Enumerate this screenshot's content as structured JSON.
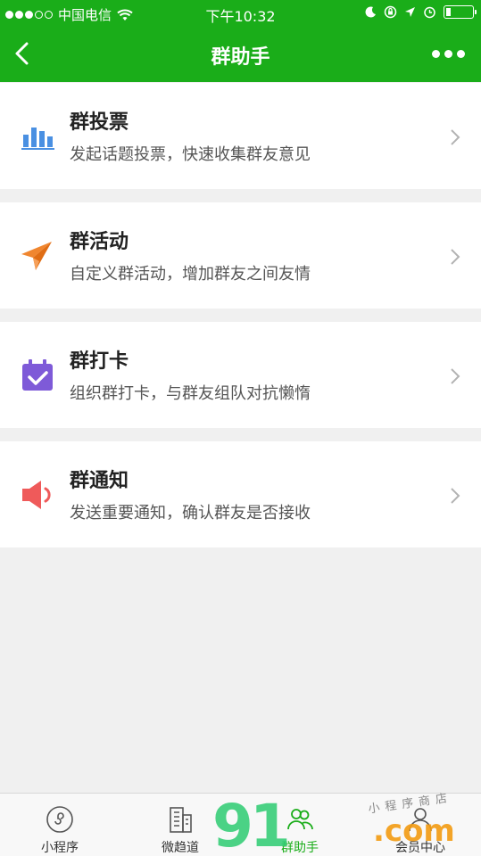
{
  "status_bar": {
    "carrier": "中国电信",
    "time": "下午10:32",
    "signal_icon": "signal-dots",
    "wifi_icon": "wifi-icon",
    "right_icons": [
      "moon-icon",
      "rotation-lock-icon",
      "location-icon",
      "alarm-icon",
      "battery-icon"
    ]
  },
  "nav": {
    "title": "群助手",
    "back_icon": "back-chevron-icon",
    "more_icon": "more-dots-icon"
  },
  "items": [
    {
      "title": "群投票",
      "desc": "发起话题投票，快速收集群友意见",
      "icon": "bar-chart-icon",
      "color": "#4a90e2"
    },
    {
      "title": "群活动",
      "desc": "自定义群活动，增加群友之间友情",
      "icon": "paper-plane-icon",
      "color": "#f0862f"
    },
    {
      "title": "群打卡",
      "desc": "组织群打卡，与群友组队对抗懒惰",
      "icon": "calendar-check-icon",
      "color": "#7e5ad8"
    },
    {
      "title": "群通知",
      "desc": "发送重要通知，确认群友是否接收",
      "icon": "speaker-icon",
      "color": "#ef5a5a"
    }
  ],
  "tabs": [
    {
      "label": "小程序",
      "icon": "mini-program-icon"
    },
    {
      "label": "微趋道",
      "icon": "building-icon"
    },
    {
      "label": "群助手",
      "icon": "group-icon",
      "active": true
    },
    {
      "label": "会员中心",
      "icon": "member-icon"
    }
  ],
  "watermark": {
    "logo": "91",
    "domain": ".com",
    "text": "小程序商店"
  },
  "colors": {
    "brand_green": "#1aad19",
    "background": "#f0f0f0"
  }
}
